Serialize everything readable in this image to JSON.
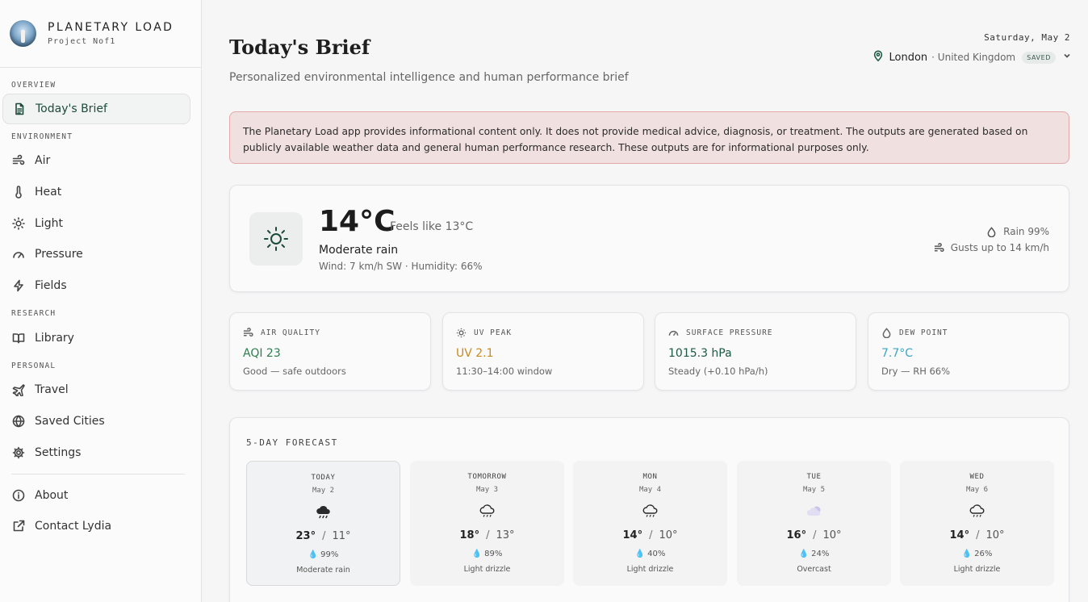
{
  "brand": {
    "title": "PLANETARY LOAD",
    "subtitle": "Project Nof1"
  },
  "sidebar": {
    "sections": {
      "overview": "OVERVIEW",
      "environment": "ENVIRONMENT",
      "research": "RESEARCH",
      "personal": "PERSONAL"
    },
    "items": {
      "brief": "Today's Brief",
      "air": "Air",
      "heat": "Heat",
      "light": "Light",
      "pressure": "Pressure",
      "fields": "Fields",
      "library": "Library",
      "travel": "Travel",
      "saved_cities": "Saved Cities",
      "settings": "Settings",
      "about": "About",
      "contact": "Contact Lydia"
    }
  },
  "header": {
    "title": "Today's Brief",
    "subtitle": "Personalized environmental intelligence and human performance brief",
    "date": "Saturday, May 2",
    "city": "London",
    "country": "· United Kingdom",
    "badge": "SAVED"
  },
  "disclaimer": "The Planetary Load app provides informational content only. It does not provide medical advice, diagnosis, or treatment. The outputs are generated based on publicly available weather data and general human performance research. These outputs are for informational purposes only.",
  "current": {
    "temp": "14°C",
    "feels": "Feels like 13°C",
    "condition": "Moderate rain",
    "details": "Wind: 7 km/h SW · Humidity: 66%",
    "rain": "Rain 99%",
    "gusts": "Gusts up to 14 km/h"
  },
  "metrics": [
    {
      "label": "AIR QUALITY",
      "value": "AQI 23",
      "sub": "Good — safe outdoors",
      "color": "#2e7d4f"
    },
    {
      "label": "UV PEAK",
      "value": "UV 2.1",
      "sub": "11:30–14:00 window",
      "color": "#c98a1d"
    },
    {
      "label": "SURFACE PRESSURE",
      "value": "1015.3 hPa",
      "sub": "Steady (+0.10 hPa/h)",
      "color": "#1d5a45"
    },
    {
      "label": "DEW POINT",
      "value": "7.7°C",
      "sub": "Dry — RH 66%",
      "color": "#3aa6c4"
    }
  ],
  "forecast": {
    "title": "5-DAY FORECAST",
    "days": [
      {
        "name": "TODAY",
        "date": "May 2",
        "hi": "23°",
        "lo": "11°",
        "rain": "99%",
        "desc": "Moderate rain",
        "icon": "rain-cloud-icon"
      },
      {
        "name": "TOMORROW",
        "date": "May 3",
        "hi": "18°",
        "lo": "13°",
        "rain": "89%",
        "desc": "Light drizzle",
        "icon": "drizzle-icon"
      },
      {
        "name": "MON",
        "date": "May 4",
        "hi": "14°",
        "lo": "10°",
        "rain": "40%",
        "desc": "Light drizzle",
        "icon": "drizzle-icon"
      },
      {
        "name": "TUE",
        "date": "May 5",
        "hi": "16°",
        "lo": "10°",
        "rain": "24%",
        "desc": "Overcast",
        "icon": "overcast-icon"
      },
      {
        "name": "WED",
        "date": "May 6",
        "hi": "14°",
        "lo": "10°",
        "rain": "26%",
        "desc": "Light drizzle",
        "icon": "drizzle-icon"
      }
    ]
  }
}
